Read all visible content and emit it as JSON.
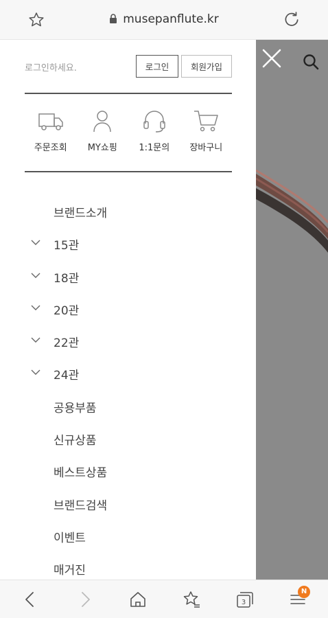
{
  "browser": {
    "url": "musepanflute.kr",
    "tabs_count": "3",
    "menu_badge": "N",
    "icons": [
      "bookmark-star-icon",
      "lock-icon",
      "reload-icon",
      "back-icon",
      "forward-icon",
      "home-icon",
      "bookmarks-icon",
      "tabs-icon",
      "menu-icon"
    ]
  },
  "drawer": {
    "login_prompt": "로그인하세요.",
    "login_button": "로그인",
    "join_button": "회원가입",
    "quick_links": [
      {
        "label": "주문조회",
        "icon": "truck-icon"
      },
      {
        "label": "MY쇼핑",
        "icon": "person-icon"
      },
      {
        "label": "1:1문의",
        "icon": "headset-icon"
      },
      {
        "label": "장바구니",
        "icon": "cart-icon"
      }
    ],
    "menu": [
      {
        "label": "브랜드소개",
        "expandable": false
      },
      {
        "label": "15관",
        "expandable": true
      },
      {
        "label": "18관",
        "expandable": true
      },
      {
        "label": "20관",
        "expandable": true
      },
      {
        "label": "22관",
        "expandable": true
      },
      {
        "label": "24관",
        "expandable": true
      },
      {
        "label": "공용부품",
        "expandable": false
      },
      {
        "label": "신규상품",
        "expandable": false
      },
      {
        "label": "베스트상품",
        "expandable": false
      },
      {
        "label": "브랜드검색",
        "expandable": false
      },
      {
        "label": "이벤트",
        "expandable": false
      },
      {
        "label": "매거진",
        "expandable": false
      }
    ]
  },
  "colors": {
    "overlay": "#8a8a8a",
    "badge": "#f07a1e",
    "rule": "#555555"
  }
}
